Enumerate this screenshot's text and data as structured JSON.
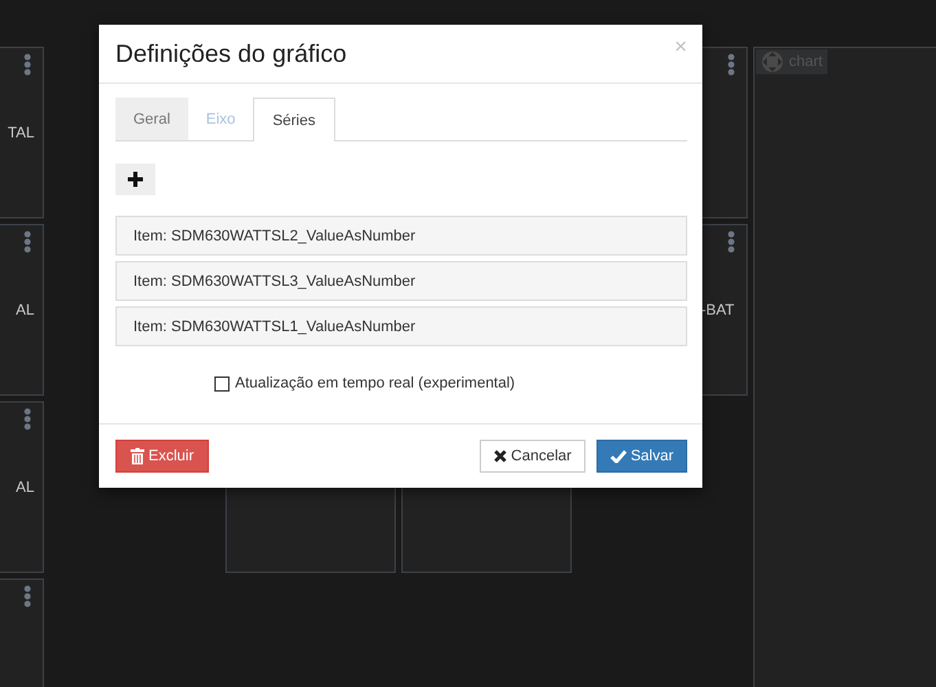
{
  "dashboard": {
    "left_tiles": [
      {
        "label": "TAL",
        "menu": true
      },
      {
        "label": "AL",
        "menu": true
      },
      {
        "label": "AL",
        "menu": true
      },
      {
        "menu": true
      }
    ],
    "right_tiles": [
      {
        "menu": true
      },
      {
        "label": "-BAT",
        "menu": true
      }
    ],
    "chart_widget": {
      "label": "chart"
    }
  },
  "dialog": {
    "title": "Definições do gráfico",
    "close": "×",
    "tabs": [
      {
        "label": "Geral",
        "selected": false,
        "disabled": false
      },
      {
        "label": "Eixo",
        "selected": false,
        "disabled": true
      },
      {
        "label": "Séries",
        "selected": true,
        "disabled": false
      }
    ],
    "series": [
      {
        "label": "Item: SDM630WATTSL2_ValueAsNumber"
      },
      {
        "label": "Item: SDM630WATTSL3_ValueAsNumber"
      },
      {
        "label": "Item: SDM630WATTSL1_ValueAsNumber"
      }
    ],
    "realtime": {
      "label": "Atualização em tempo real (experimental)",
      "checked": false
    },
    "buttons": [
      {
        "kind": "delete",
        "label": "Excluir"
      },
      {
        "kind": "cancel",
        "label": "Cancelar"
      },
      {
        "kind": "save",
        "label": "Salvar"
      }
    ]
  }
}
